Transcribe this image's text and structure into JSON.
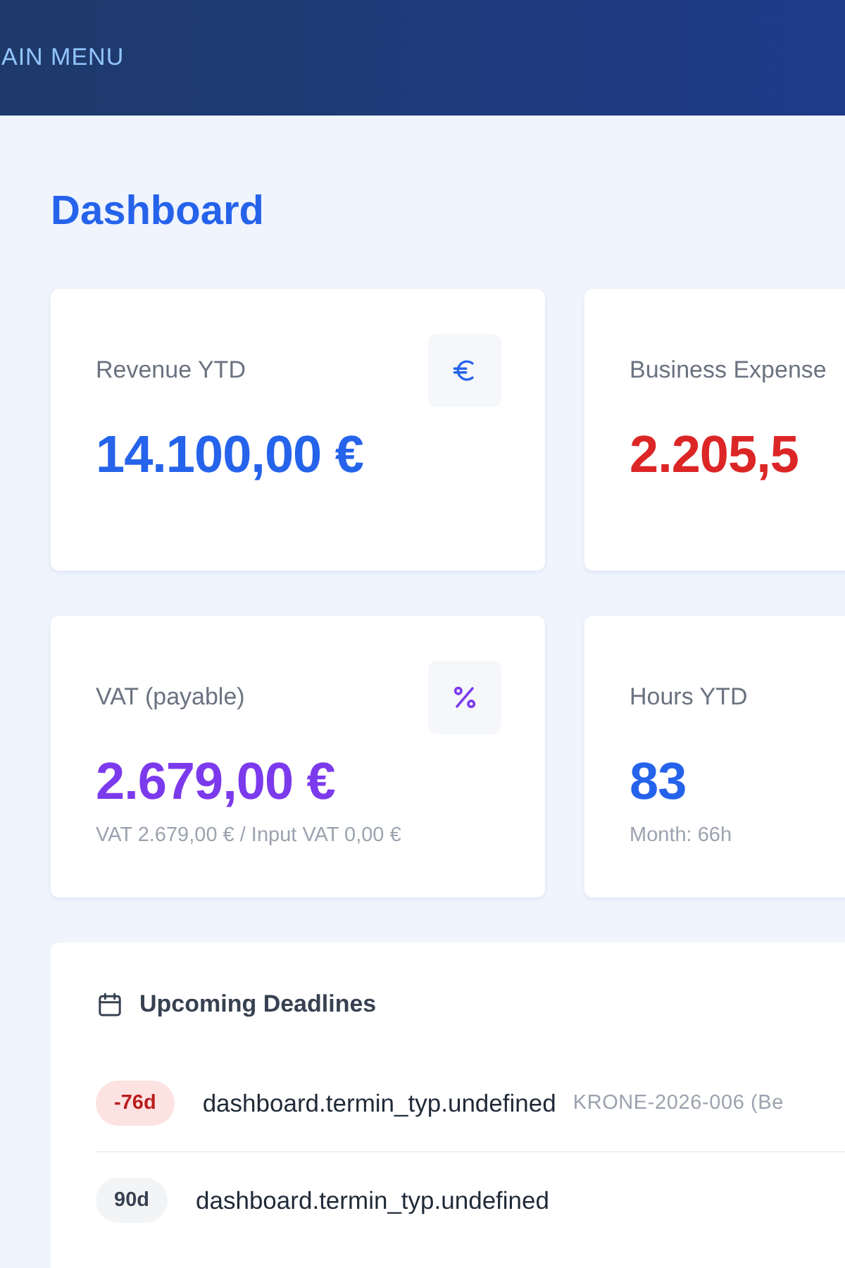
{
  "header": {
    "menu_label": "AIN MENU"
  },
  "page_title": "Dashboard",
  "stat_cards": [
    {
      "kind": "euro",
      "label": "Revenue YTD",
      "value": "14.100,00 €",
      "color": "#2563eb"
    },
    {
      "kind": "plain",
      "label": "Business Expense",
      "value": "2.205,5",
      "color": "#dc2626"
    },
    {
      "kind": "percent",
      "label": "VAT (payable)",
      "value": "2.679,00 €",
      "color": "#7c3aed",
      "note": "VAT 2.679,00 € / Input VAT 0,00 €"
    },
    {
      "kind": "plain",
      "label": "Hours YTD",
      "value": "83",
      "color": "#2563eb",
      "note": "Month: 66h"
    }
  ],
  "deadlines": {
    "title": "Upcoming Deadlines",
    "items": [
      {
        "kind": "overdue",
        "days": "-76d",
        "title": "dashboard.termin_typ.undefined",
        "reference": "KRONE-2026-006 (Be"
      },
      {
        "kind": "upcoming",
        "days": "90d",
        "title": "dashboard.termin_typ.undefined"
      }
    ]
  }
}
